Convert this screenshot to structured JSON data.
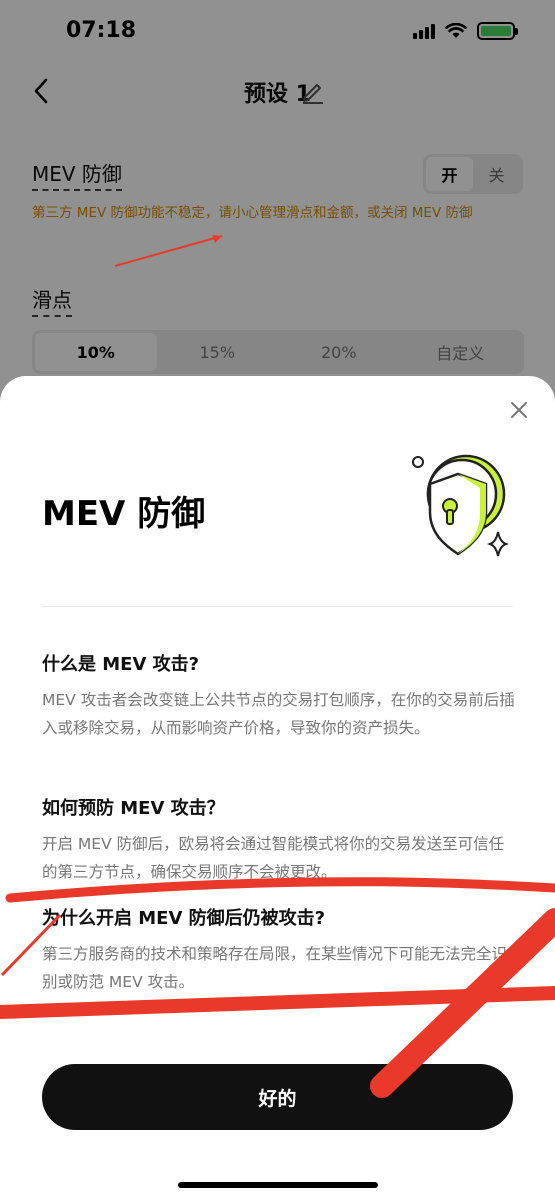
{
  "status_bar": {
    "time": "07:18"
  },
  "nav": {
    "title": "预设 1"
  },
  "settings": {
    "mev_label": "MEV 防御",
    "toggle_on": "开",
    "toggle_off": "关",
    "warning": "第三方 MEV 防御功能不稳定，请小心管理滑点和金额，或关闭 MEV 防御",
    "slippage_label": "滑点",
    "slippage_options": [
      "10%",
      "15%",
      "20%",
      "自定义"
    ]
  },
  "sheet": {
    "title": "MEV 防御",
    "q1": {
      "title": "什么是 MEV 攻击?",
      "body": "MEV 攻击者会改变链上公共节点的交易打包顺序，在你的交易前后插入或移除交易，从而影响资产价格，导致你的资产损失。"
    },
    "q2": {
      "title": "如何预防 MEV 攻击？",
      "body": "开启 MEV 防御后，欧易将会通过智能模式将你的交易发送至可信任的第三方节点，确保交易顺序不会被更改。"
    },
    "q3": {
      "title": "为什么开启 MEV 防御后仍被攻击?",
      "body": "第三方服务商的技术和策略存在局限，在某些情况下可能无法完全识别或防范 MEV 攻击。"
    },
    "ok_button": "好的"
  },
  "icons": [
    "back-icon",
    "edit-icon",
    "close-icon",
    "shield-lock-illustration",
    "wifi-icon",
    "battery-icon",
    "signal-icon"
  ],
  "colors": {
    "warning": "#d68a00",
    "accent_green": "#c8f03c",
    "annotation_red": "#e8392a",
    "button": "#111111"
  }
}
